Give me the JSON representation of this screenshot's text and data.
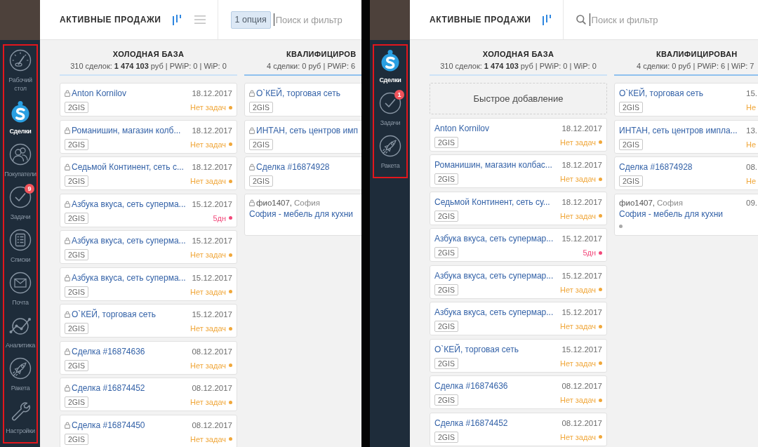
{
  "panels": [
    {
      "sidebar": {
        "highlighted": true,
        "items": [
          {
            "kind": "gauge",
            "label": "Рабочий стол",
            "selected": false
          },
          {
            "kind": "bag",
            "label": "Сделки",
            "selected": true
          },
          {
            "kind": "people",
            "label": "Покупатели",
            "selected": false
          },
          {
            "kind": "check",
            "label": "Задачи",
            "selected": false,
            "badge": "9"
          },
          {
            "kind": "list",
            "label": "Списки",
            "selected": false
          },
          {
            "kind": "mail",
            "label": "Почта",
            "selected": false
          },
          {
            "kind": "chart",
            "label": "Аналитика",
            "selected": false
          },
          {
            "kind": "rocket",
            "label": "Ракета",
            "selected": false
          },
          {
            "kind": "wrench",
            "label": "Настройки",
            "selected": false
          }
        ]
      },
      "header": {
        "title": "АКТИВНЫЕ ПРОДАЖИ",
        "views": [
          {
            "kind": "pipeline",
            "selected": true
          },
          {
            "kind": "list",
            "selected": false
          }
        ],
        "search": {
          "chip": "1 опция",
          "placeholder": "Поиск и фильтр",
          "focused": true
        }
      },
      "columns": [
        {
          "title": "ХОЛОДНАЯ БАЗА",
          "summary": "310 сделок: **1 474 103** руб | PWiP: 0 | WiP: 0",
          "color": "#cde2f7",
          "cards": [
            {
              "kind": "deal",
              "locked": true,
              "title": "Anton Kornilov",
              "date": "18.12.2017",
              "tag": "2GIS",
              "status": {
                "text": "Нет задач",
                "color": "#f0a73a"
              }
            },
            {
              "kind": "deal",
              "locked": true,
              "title": "Романишин, магазин колб...",
              "date": "18.12.2017",
              "tag": "2GIS",
              "status": {
                "text": "Нет задач",
                "color": "#f0a73a"
              }
            },
            {
              "kind": "deal",
              "locked": true,
              "title": "Седьмой Континент, сеть с...",
              "date": "18.12.2017",
              "tag": "2GIS",
              "status": {
                "text": "Нет задач",
                "color": "#f0a73a"
              }
            },
            {
              "kind": "deal",
              "locked": true,
              "title": "Азбука вкуса, сеть суперма...",
              "date": "15.12.2017",
              "tag": "2GIS",
              "status": {
                "text": "5дн",
                "color": "#f2487a"
              }
            },
            {
              "kind": "deal",
              "locked": true,
              "title": "Азбука вкуса, сеть суперма...",
              "date": "15.12.2017",
              "tag": "2GIS",
              "status": {
                "text": "Нет задач",
                "color": "#f0a73a"
              }
            },
            {
              "kind": "deal",
              "locked": true,
              "title": "Азбука вкуса, сеть суперма...",
              "date": "15.12.2017",
              "tag": "2GIS",
              "status": {
                "text": "Нет задач",
                "color": "#f0a73a"
              }
            },
            {
              "kind": "deal",
              "locked": true,
              "title": "О`КЕЙ, торговая сеть",
              "date": "15.12.2017",
              "tag": "2GIS",
              "status": {
                "text": "Нет задач",
                "color": "#f0a73a"
              }
            },
            {
              "kind": "deal",
              "locked": true,
              "title": "Сделка #16874636",
              "date": "08.12.2017",
              "tag": "2GIS",
              "status": {
                "text": "Нет задач",
                "color": "#f0a73a"
              }
            },
            {
              "kind": "deal",
              "locked": true,
              "title": "Сделка #16874452",
              "date": "08.12.2017",
              "tag": "2GIS",
              "status": {
                "text": "Нет задач",
                "color": "#f0a73a"
              }
            },
            {
              "kind": "deal",
              "locked": true,
              "title": "Сделка #16874450",
              "date": "08.12.2017",
              "tag": "2GIS",
              "status": {
                "text": "Нет задач",
                "color": "#f0a73a"
              }
            }
          ]
        },
        {
          "title": "КВАЛИФИЦИРОВ",
          "summary": "4 сделки: 0 руб | PWiP: 6",
          "color": "#8fc1ef",
          "cards": [
            {
              "kind": "deal",
              "locked": true,
              "title": "О`КЕЙ, торговая сеть",
              "tag": "2GIS"
            },
            {
              "kind": "deal",
              "locked": true,
              "title": "ИНТАН, сеть центров имп",
              "tag": "2GIS"
            },
            {
              "kind": "deal",
              "locked": true,
              "title": "Сделка #16874928",
              "tag": "2GIS"
            },
            {
              "kind": "contact",
              "locked": true,
              "contact": "фио1407,",
              "company": "София",
              "title": "София - мебель для кухни"
            }
          ]
        }
      ]
    },
    {
      "sidebar": {
        "highlighted": true,
        "items": [
          {
            "kind": "bag",
            "label": "Сделки",
            "selected": true
          },
          {
            "kind": "check",
            "label": "Задачи",
            "selected": false,
            "badge": "1"
          },
          {
            "kind": "rocket",
            "label": "Ракета",
            "selected": false
          }
        ]
      },
      "header": {
        "title": "АКТИВНЫЕ ПРОДАЖИ",
        "views": [
          {
            "kind": "pipeline",
            "selected": true
          }
        ],
        "search": {
          "icon": true,
          "placeholder": "Поиск и фильтр",
          "focused": true
        }
      },
      "columns": [
        {
          "title": "ХОЛОДНАЯ БАЗА",
          "summary": "310 сделок: **1 474 103** руб | PWiP: 0 | WiP: 0",
          "color": "#cde2f7",
          "quick_add": "Быстрое добавление",
          "cards": [
            {
              "kind": "deal",
              "locked": false,
              "title": "Anton Kornilov",
              "date": "18.12.2017",
              "tag": "2GIS",
              "status": {
                "text": "Нет задач",
                "color": "#f0a73a"
              }
            },
            {
              "kind": "deal",
              "locked": false,
              "title": "Романишин, магазин колбас...",
              "date": "18.12.2017",
              "tag": "2GIS",
              "status": {
                "text": "Нет задач",
                "color": "#f0a73a"
              }
            },
            {
              "kind": "deal",
              "locked": false,
              "title": "Седьмой Континент, сеть су...",
              "date": "18.12.2017",
              "tag": "2GIS",
              "status": {
                "text": "Нет задач",
                "color": "#f0a73a"
              }
            },
            {
              "kind": "deal",
              "locked": false,
              "title": "Азбука вкуса, сеть супермар...",
              "date": "15.12.2017",
              "tag": "2GIS",
              "status": {
                "text": "5дн",
                "color": "#f2487a"
              }
            },
            {
              "kind": "deal",
              "locked": false,
              "title": "Азбука вкуса, сеть супермар...",
              "date": "15.12.2017",
              "tag": "2GIS",
              "status": {
                "text": "Нет задач",
                "color": "#f0a73a"
              }
            },
            {
              "kind": "deal",
              "locked": false,
              "title": "Азбука вкуса, сеть супермар...",
              "date": "15.12.2017",
              "tag": "2GIS",
              "status": {
                "text": "Нет задач",
                "color": "#f0a73a"
              }
            },
            {
              "kind": "deal",
              "locked": false,
              "title": "О`КЕЙ, торговая сеть",
              "date": "15.12.2017",
              "tag": "2GIS",
              "status": {
                "text": "Нет задач",
                "color": "#f0a73a"
              }
            },
            {
              "kind": "deal",
              "locked": false,
              "title": "Сделка #16874636",
              "date": "08.12.2017",
              "tag": "2GIS",
              "status": {
                "text": "Нет задач",
                "color": "#f0a73a"
              }
            },
            {
              "kind": "deal",
              "locked": false,
              "title": "Сделка #16874452",
              "date": "08.12.2017",
              "tag": "2GIS",
              "status": {
                "text": "Нет задач",
                "color": "#f0a73a"
              }
            }
          ]
        },
        {
          "title": "КВАЛИФИЦИРОВАН",
          "summary": "4 сделки: 0 руб | PWiP: 6 | WiP: 7",
          "color": "#8fc1ef",
          "cards": [
            {
              "kind": "deal",
              "locked": false,
              "title": "О`КЕЙ, торговая сеть",
              "date": "15.",
              "tag": "2GIS",
              "status": {
                "text": "Не",
                "color": "#f0a73a"
              }
            },
            {
              "kind": "deal",
              "locked": false,
              "title": "ИНТАН, сеть центров импла...",
              "date": "13.",
              "tag": "2GIS",
              "status": {
                "text": "Не",
                "color": "#f0a73a"
              }
            },
            {
              "kind": "deal",
              "locked": false,
              "title": "Сделка #16874928",
              "date": "08.",
              "tag": "2GIS",
              "status": {
                "text": "Не",
                "color": "#f0a73a"
              }
            },
            {
              "kind": "contact",
              "locked": false,
              "contact": "фио1407,",
              "company": "София",
              "date": "09.",
              "title": "София - мебель для кухни",
              "status": {
                "color": "#a9a9a9"
              }
            }
          ]
        }
      ]
    }
  ]
}
